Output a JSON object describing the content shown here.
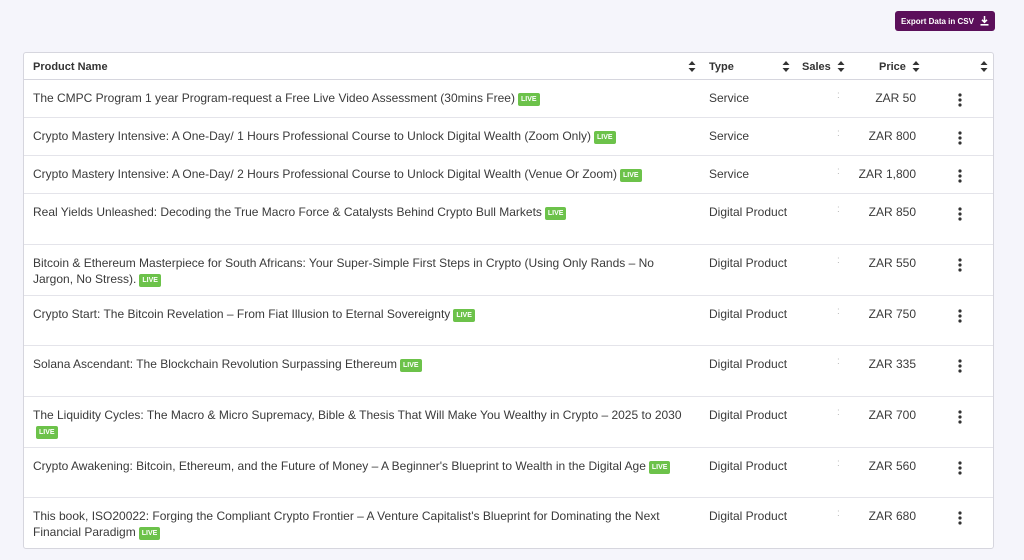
{
  "toolbar": {
    "export_label": "Export Data in CSV"
  },
  "table": {
    "headers": {
      "name": "Product Name",
      "type": "Type",
      "sales": "Sales",
      "price": "Price"
    },
    "rows": [
      {
        "name": "The CMPC Program 1 year Program-request a Free Live Video Assessment (30mins Free)",
        "badge": "LIVE",
        "type": "Service",
        "sales": ":",
        "price": "ZAR 50"
      },
      {
        "name": "Crypto Mastery Intensive: A One-Day/ 1 Hours Professional Course to Unlock Digital Wealth (Zoom Only)",
        "badge": "LIVE",
        "type": "Service",
        "sales": ":",
        "price": "ZAR 800"
      },
      {
        "name": "Crypto Mastery Intensive: A One-Day/ 2 Hours Professional Course to Unlock Digital Wealth (Venue Or Zoom)",
        "badge": "LIVE",
        "type": "Service",
        "sales": ":",
        "price": "ZAR 1,800"
      },
      {
        "name": "Real Yields Unleashed: Decoding the True Macro Force & Catalysts Behind Crypto Bull Markets",
        "badge": "LIVE",
        "type": "Digital Product",
        "sales": ":",
        "price": "ZAR 850"
      },
      {
        "name": "Bitcoin & Ethereum Masterpiece for South Africans: Your Super-Simple First Steps in Crypto (Using Only Rands – No Jargon, No Stress).",
        "badge": "LIVE",
        "type": "Digital Product",
        "sales": ":",
        "price": "ZAR 550"
      },
      {
        "name": "Crypto Start: The Bitcoin Revelation – From Fiat Illusion to Eternal Sovereignty",
        "badge": "LIVE",
        "type": "Digital Product",
        "sales": ":",
        "price": "ZAR 750"
      },
      {
        "name": "Solana Ascendant: The Blockchain Revolution Surpassing Ethereum",
        "badge": "LIVE",
        "type": "Digital Product",
        "sales": ":",
        "price": "ZAR 335"
      },
      {
        "name": "The Liquidity Cycles: The Macro & Micro Supremacy, Bible & Thesis That Will Make You Wealthy in Crypto – 2025 to 2030",
        "badge": "LIVE",
        "type": "Digital Product",
        "sales": ":",
        "price": "ZAR 700"
      },
      {
        "name": "Crypto Awakening: Bitcoin, Ethereum, and the Future of Money – A Beginner's Blueprint to Wealth in the Digital Age",
        "badge": "LIVE",
        "type": "Digital Product",
        "sales": ":",
        "price": "ZAR 560"
      },
      {
        "name": "This book, ISO20022: Forging the Compliant Crypto Frontier – A Venture Capitalist's Blueprint for Dominating the Next Financial Paradigm",
        "badge": "LIVE",
        "type": "Digital Product",
        "sales": ":",
        "price": "ZAR 680"
      }
    ]
  },
  "colors": {
    "export_button": "#5b0f5a",
    "live_badge": "#6cc24a"
  },
  "icons": {
    "export": "download-icon",
    "sort": "sort-icon",
    "row_menu": "more-vertical-icon"
  }
}
